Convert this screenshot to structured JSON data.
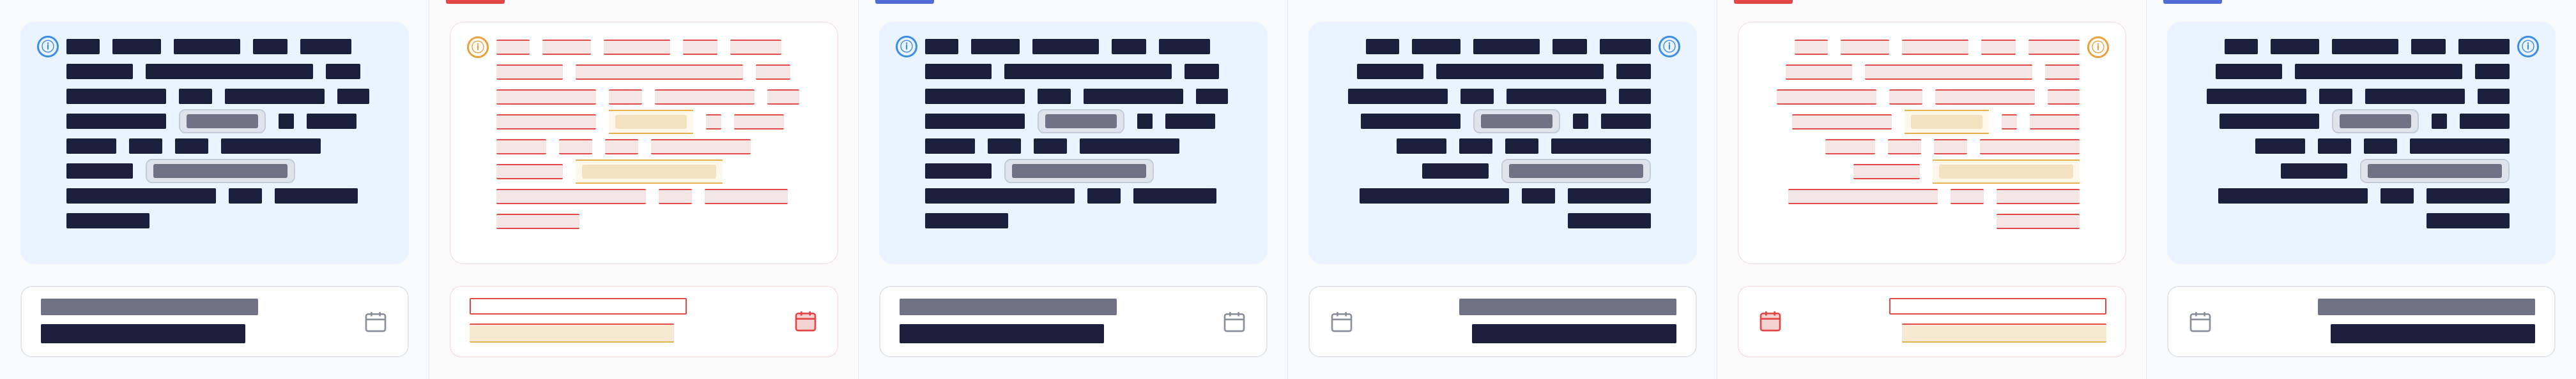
{
  "colors": {
    "info_card_bg": "#eaf3ff",
    "info_icon": "#3b8fe0",
    "warning_icon": "#e8a23d",
    "text_dark": "#1b1f3b",
    "text_muted": "#6f7385",
    "highlight_red": "#e34848",
    "highlight_amber": "#e8b24a",
    "accent_red": "#e34848",
    "accent_blue": "#4f6bd6"
  },
  "icons": {
    "info": "ⓘ",
    "calendar": "calendar-icon"
  },
  "panels": [
    {
      "info_icon": "ⓘ",
      "message": {
        "line1": "",
        "line2": "",
        "line3": "",
        "line4": "",
        "chip1": "",
        "line5": "",
        "line6": "",
        "chip2": "",
        "line7": "",
        "line8": ""
      },
      "date_label": "",
      "date_value": ""
    },
    {
      "info_icon": "ⓘ",
      "message": {
        "line1": "",
        "line2": "",
        "line3": "",
        "line4": "",
        "chip1": "",
        "line5": "",
        "line6": "",
        "chip2": "",
        "line7": "",
        "line8": ""
      },
      "date_label": "",
      "date_value": ""
    },
    {
      "info_icon": "ⓘ",
      "message": {
        "line1": "",
        "line2": "",
        "line3": "",
        "line4": "",
        "chip1": "",
        "line5": "",
        "line6": "",
        "chip2": "",
        "line7": "",
        "line8": ""
      },
      "date_label": "",
      "date_value": ""
    },
    {
      "info_icon": "ⓘ",
      "message": {
        "line1": "",
        "line2": "",
        "line3": "",
        "line4": "",
        "chip1": "",
        "line5": "",
        "line6": "",
        "chip2": "",
        "line7": "",
        "line8": ""
      },
      "date_label": "",
      "date_value": ""
    },
    {
      "info_icon": "ⓘ",
      "message": {
        "line1": "",
        "line2": "",
        "line3": "",
        "line4": "",
        "chip1": "",
        "line5": "",
        "line6": "",
        "chip2": "",
        "line7": "",
        "line8": ""
      },
      "date_label": "",
      "date_value": ""
    },
    {
      "info_icon": "ⓘ",
      "message": {
        "line1": "",
        "line2": "",
        "line3": "",
        "line4": "",
        "chip1": "",
        "line5": "",
        "line6": "",
        "chip2": "",
        "line7": "",
        "line8": ""
      },
      "date_label": "",
      "date_value": ""
    }
  ]
}
